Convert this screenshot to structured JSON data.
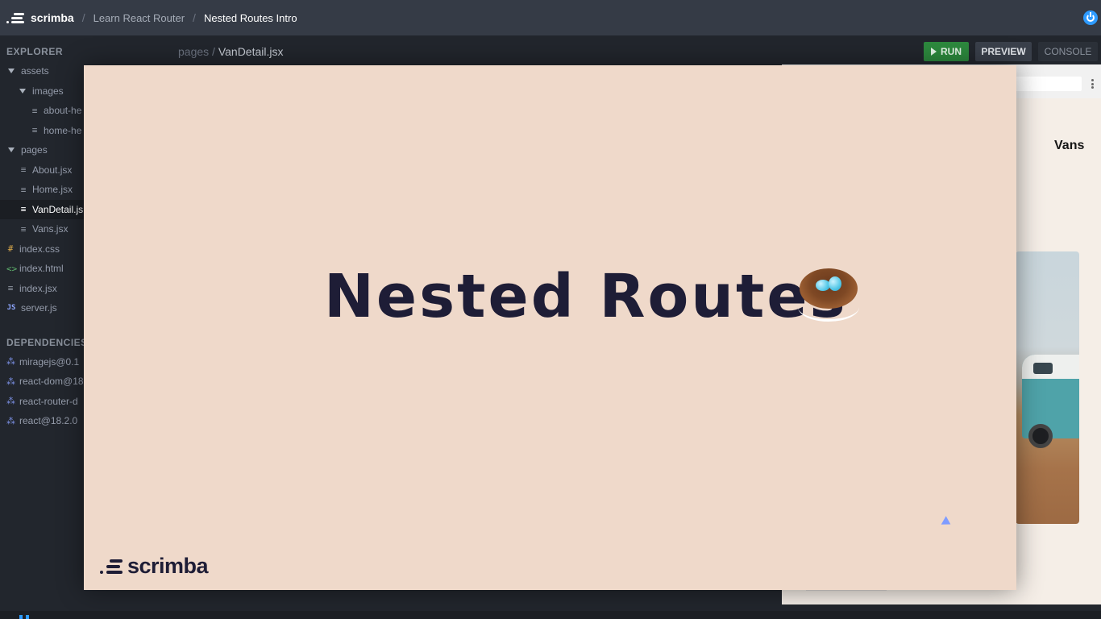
{
  "topbar": {
    "brand": "scrimba",
    "breadcrumbs": [
      "Learn React Router",
      "Nested Routes Intro"
    ]
  },
  "sidebar": {
    "explorer_title": "EXPLORER",
    "files": [
      {
        "label": "assets",
        "kind": "folder"
      },
      {
        "label": "images",
        "kind": "folder"
      },
      {
        "label": "about-he",
        "kind": "file"
      },
      {
        "label": "home-he",
        "kind": "file"
      },
      {
        "label": "pages",
        "kind": "folder"
      },
      {
        "label": "About.jsx",
        "kind": "file"
      },
      {
        "label": "Home.jsx",
        "kind": "file"
      },
      {
        "label": "VanDetail.js",
        "kind": "file"
      },
      {
        "label": "Vans.jsx",
        "kind": "file"
      },
      {
        "label": "index.css",
        "kind": "css"
      },
      {
        "label": "index.html",
        "kind": "html"
      },
      {
        "label": "index.jsx",
        "kind": "file"
      },
      {
        "label": "server.js",
        "kind": "js"
      }
    ],
    "dependencies_title": "DEPENDENCIES",
    "dependencies": [
      "miragejs@0.1",
      "react-dom@18",
      "react-router-d",
      "react@18.2.0"
    ]
  },
  "editor": {
    "path_prefix": "pages /",
    "file_name": "VanDetail.jsx"
  },
  "toolbar": {
    "run_label": "RUN",
    "preview_label": "PREVIEW",
    "console_label": "CONSOLE"
  },
  "preview": {
    "nav_partial": "t",
    "nav_vans": "Vans"
  },
  "slide": {
    "title": "Nested Routes",
    "brand": "scrimba"
  },
  "colors": {
    "topbar": "#353b46",
    "sidebar": "#22262d",
    "run_button": "#2d8a3e",
    "slide_bg": "#efd9ca",
    "slide_text": "#1e1d36",
    "accent": "#2e9bff"
  }
}
